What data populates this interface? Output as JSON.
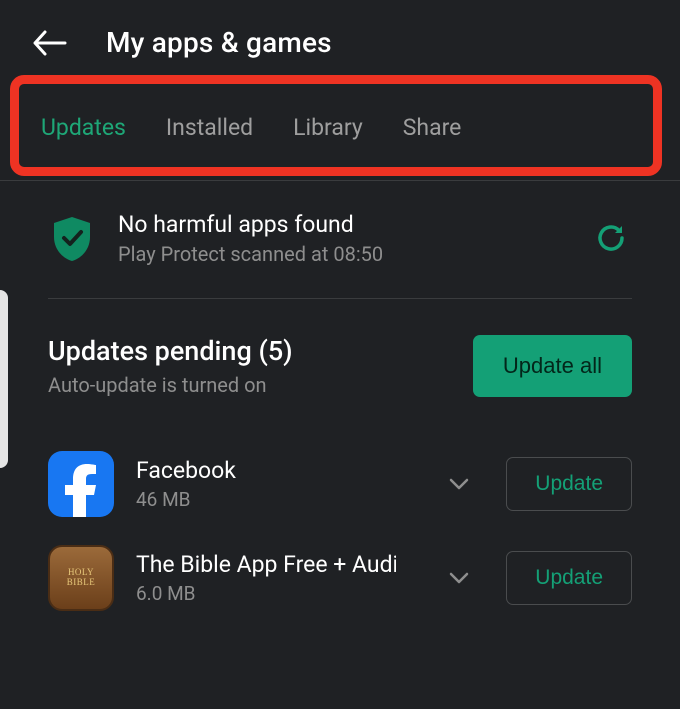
{
  "header": {
    "title": "My apps & games"
  },
  "tabs": [
    {
      "label": "Updates",
      "active": true
    },
    {
      "label": "Installed",
      "active": false
    },
    {
      "label": "Library",
      "active": false
    },
    {
      "label": "Share",
      "active": false
    }
  ],
  "protect": {
    "title": "No harmful apps found",
    "subtitle": "Play Protect scanned at 08:50"
  },
  "pending": {
    "title": "Updates pending (5)",
    "subtitle": "Auto-update is turned on",
    "update_all_label": "Update all"
  },
  "apps": [
    {
      "name": "Facebook",
      "size": "46 MB",
      "update_label": "Update",
      "icon": "fb"
    },
    {
      "name": "The Bible App Free + Audio, O",
      "size": "6.0 MB",
      "update_label": "Update",
      "icon": "bible"
    }
  ],
  "bible_icon_text": {
    "line1": "HOLY",
    "line2": "BIBLE"
  }
}
